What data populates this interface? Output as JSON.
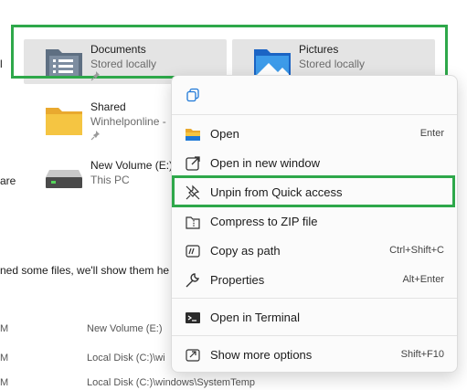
{
  "quick_access": {
    "left_cut_labels": [
      "l",
      "are"
    ],
    "tiles": [
      {
        "label": "Documents",
        "status": "Stored locally"
      },
      {
        "label": "Pictures",
        "status": "Stored locally"
      }
    ],
    "items": [
      {
        "label": "Shared",
        "location": "Winhelponline -"
      },
      {
        "label": "New Volume (E:)",
        "location": "This PC"
      }
    ]
  },
  "recent": {
    "empty_message": "ned some files, we'll show them he",
    "rows": [
      {
        "time": "M",
        "location": "New Volume (E:)"
      },
      {
        "time": "M",
        "location": "Local Disk (C:)\\wi"
      },
      {
        "time": "M",
        "location": "Local Disk (C:)\\windows\\SystemTemp"
      }
    ]
  },
  "context_menu": {
    "copy_icon": "copy-icon",
    "items": [
      {
        "label": "Open",
        "shortcut": "Enter",
        "icon": "folder-icon"
      },
      {
        "label": "Open in new window",
        "shortcut": "",
        "icon": "open-new-window-icon"
      },
      {
        "label": "Unpin from Quick access",
        "shortcut": "",
        "icon": "unpin-icon"
      },
      {
        "label": "Compress to ZIP file",
        "shortcut": "",
        "icon": "zip-icon"
      },
      {
        "label": "Copy as path",
        "shortcut": "Ctrl+Shift+C",
        "icon": "copy-path-icon"
      },
      {
        "label": "Properties",
        "shortcut": "Alt+Enter",
        "icon": "wrench-icon"
      },
      {
        "label": "Open in Terminal",
        "shortcut": "",
        "icon": "terminal-icon"
      },
      {
        "label": "Show more options",
        "shortcut": "Shift+F10",
        "icon": "show-more-icon"
      }
    ]
  },
  "colors": {
    "highlight_box": "#2ea84a",
    "folder_yellow": "#f5c542",
    "accent_blue": "#1e78d7"
  }
}
